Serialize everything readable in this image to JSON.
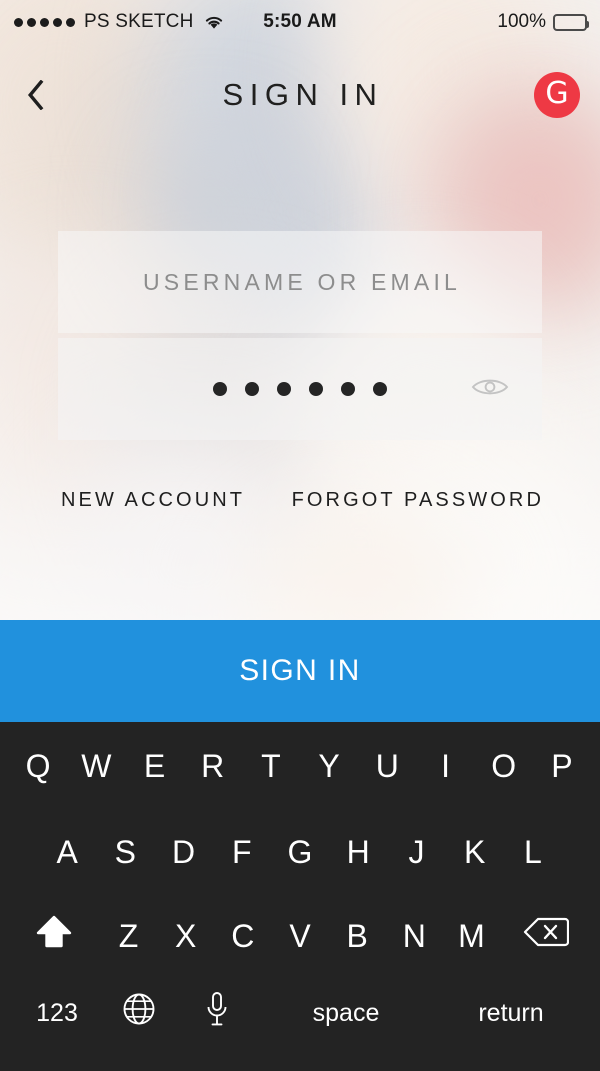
{
  "status_bar": {
    "signal_dots": 5,
    "carrier": "PS SKETCH",
    "wifi_icon": "wifi-icon",
    "time": "5:50 AM",
    "battery_percent": "100%",
    "battery_icon": "battery-full-icon"
  },
  "header": {
    "back_icon": "chevron-left-icon",
    "title": "SIGN IN",
    "logo_letter": "G",
    "logo_name": "brand-logo-g-icon",
    "logo_color": "#ee3944"
  },
  "form": {
    "username": {
      "placeholder": "USERNAME OR EMAIL",
      "value": ""
    },
    "password": {
      "masked_char_count": 6,
      "value": "••••••",
      "reveal_icon": "eye-icon"
    }
  },
  "links": {
    "new_account": "NEW ACCOUNT",
    "forgot_password": "FORGOT PASSWORD"
  },
  "primary_action": {
    "label": "SIGN IN",
    "color": "#2191dd"
  },
  "keyboard": {
    "background": "#232323",
    "row1": [
      "Q",
      "W",
      "E",
      "R",
      "T",
      "Y",
      "U",
      "I",
      "O",
      "P"
    ],
    "row2": [
      "A",
      "S",
      "D",
      "F",
      "G",
      "H",
      "J",
      "K",
      "L"
    ],
    "row3": [
      "Z",
      "X",
      "C",
      "V",
      "B",
      "N",
      "M"
    ],
    "shift_icon": "shift-arrow-icon",
    "delete_icon": "backspace-icon",
    "numbers_key": "123",
    "globe_icon": "globe-icon",
    "mic_icon": "microphone-icon",
    "space_key": "space",
    "return_key": "return"
  },
  "background": {
    "description": "blurred-photo-people",
    "tones": [
      "#f0e6dd",
      "#e8dcd4",
      "#cfd4dc",
      "#f7f3ef",
      "#e3c9c2"
    ]
  }
}
